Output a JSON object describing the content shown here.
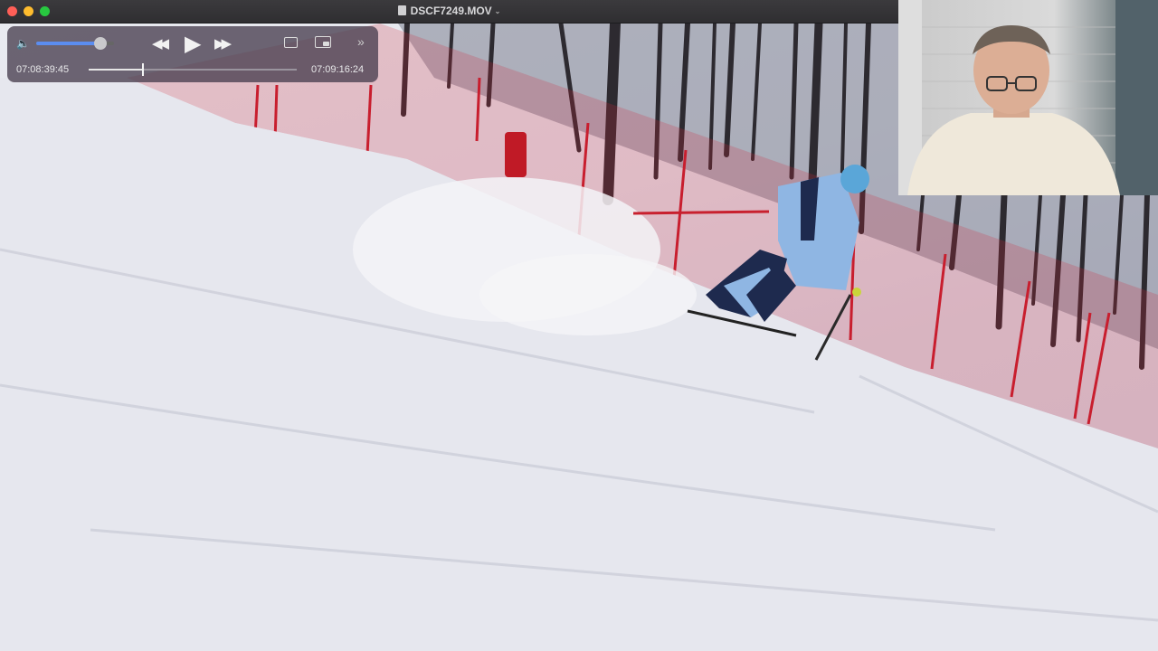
{
  "window": {
    "title": "DSCF7249.MOV",
    "title_chevron": "⌄"
  },
  "player": {
    "volume_icon": "speaker-icon",
    "volume_level": 0.82,
    "current_time": "07:08:39:45",
    "end_time": "07:09:16:24",
    "playback_position": 0.26,
    "rewind_glyph": "◀◀",
    "play_glyph": "▶",
    "forward_glyph": "▶▶",
    "more_glyph": "»",
    "icons": [
      "rewind-icon",
      "play-icon",
      "fast-forward-icon",
      "airplay-icon",
      "picture-in-picture-icon",
      "more-icon"
    ]
  },
  "colors": {
    "titlebar": "#3b3a3d",
    "accent_volume": "#5b8df0",
    "net": "#d22a3a",
    "skier_suit_light": "#8fb6e3",
    "skier_suit_dark": "#1e2a4e"
  }
}
